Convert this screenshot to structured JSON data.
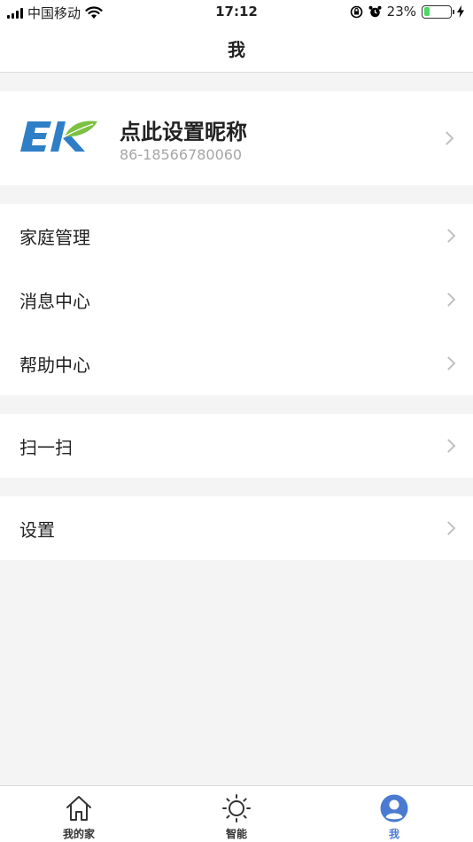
{
  "status_bar": {
    "carrier": "中国移动",
    "time": "17:12",
    "battery_percent": "23%",
    "battery_level": 0.23,
    "icons": [
      "signal-icon",
      "wifi-icon",
      "rotation-lock-icon",
      "alarm-icon",
      "battery-icon",
      "charging-icon"
    ]
  },
  "nav": {
    "title": "我"
  },
  "profile": {
    "logo_icon": "ek-logo",
    "nickname": "点此设置昵称",
    "phone": "86-18566780060"
  },
  "menu_groups": [
    {
      "items": [
        {
          "label": "家庭管理"
        },
        {
          "label": "消息中心"
        },
        {
          "label": "帮助中心"
        }
      ]
    },
    {
      "items": [
        {
          "label": "扫一扫"
        }
      ]
    },
    {
      "items": [
        {
          "label": "设置"
        }
      ]
    }
  ],
  "tabs": [
    {
      "label": "我的家",
      "icon": "home-icon",
      "active": false
    },
    {
      "label": "智能",
      "icon": "sun-icon",
      "active": false
    },
    {
      "label": "我",
      "icon": "user-icon",
      "active": true
    }
  ],
  "colors": {
    "accent": "#4a7bd0",
    "logo_blue": "#2f7fc6",
    "logo_green": "#7cc142",
    "background": "#f4f4f4"
  }
}
